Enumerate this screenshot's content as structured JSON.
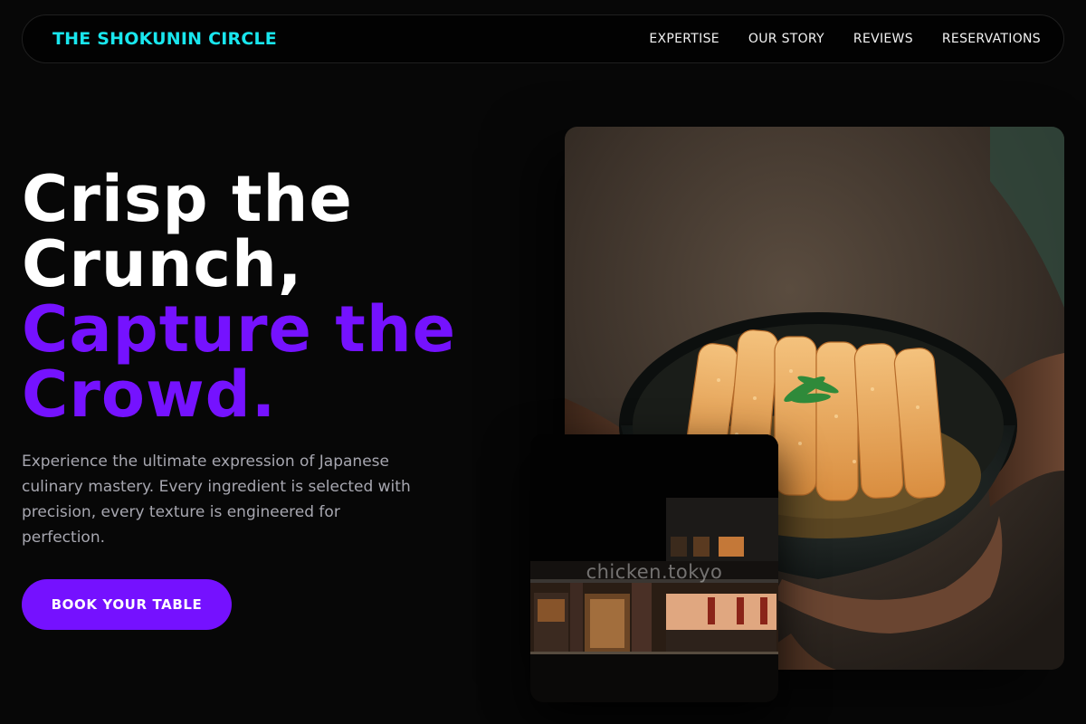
{
  "nav": {
    "brand": "THE SHOKUNIN CIRCLE",
    "links": [
      "EXPERTISE",
      "OUR STORY",
      "REVIEWS",
      "RESERVATIONS"
    ]
  },
  "hero": {
    "headline_line1": "Crisp the",
    "headline_line2": "Crunch,",
    "headline_line3": "Capture the",
    "headline_line4": "Crowd.",
    "description": "Experience the ultimate expression of Japanese culinary mastery. Every ingredient is selected with precision, every texture is engineered for perfection.",
    "cta_label": "BOOK YOUR TABLE"
  },
  "images": {
    "hero_photo": "tonkatsu-bowl-photo",
    "store_photo": "storefront-photo",
    "store_watermark": "chicken.tokyo"
  },
  "colors": {
    "brand": "#19e6ee",
    "accent": "#7511ff",
    "background": "#070707",
    "body_text": "#a7a7b0"
  }
}
